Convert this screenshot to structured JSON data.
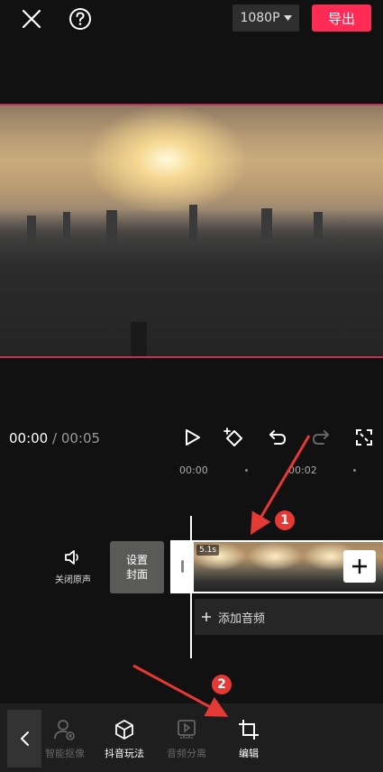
{
  "topbar": {
    "resolution": "1080P",
    "export_label": "导出"
  },
  "icons": {
    "close": "close-icon",
    "help": "help-icon",
    "play": "play-icon",
    "keyframe": "keyframe-add-icon",
    "undo": "undo-icon",
    "redo": "redo-icon",
    "fullscreen": "fullscreen-icon"
  },
  "playback": {
    "current_time": "00:00",
    "separator": " / ",
    "total_time": "00:05"
  },
  "ruler": {
    "tick_0": "00:00",
    "tick_2": "00:02"
  },
  "tracks": {
    "mute_label": "关闭原声",
    "cover_line1": "设置",
    "cover_line2": "封面",
    "clip_duration": "5.1s",
    "add_audio_label": "添加音频"
  },
  "toolbar": {
    "items": [
      {
        "label": "智能抠像",
        "enabled": false
      },
      {
        "label": "抖音玩法",
        "enabled": true
      },
      {
        "label": "音频分离",
        "enabled": false
      },
      {
        "label": "编辑",
        "enabled": true
      }
    ]
  },
  "annotations": {
    "badge_1": "1",
    "badge_2": "2",
    "color": "#e53935"
  },
  "colors": {
    "accent": "#fe2c55",
    "frame_border": "#c0305a"
  }
}
